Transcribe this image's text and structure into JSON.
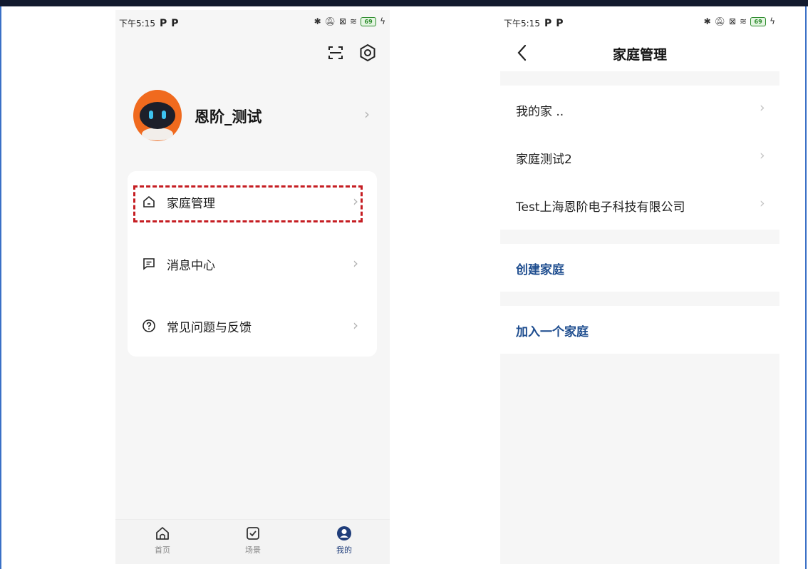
{
  "status_bar": {
    "time": "下午5:15",
    "battery": "69"
  },
  "left_screen": {
    "profile": {
      "name": "恩阶_测试"
    },
    "menu": [
      {
        "label": "家庭管理",
        "icon": "home-outline-icon"
      },
      {
        "label": "消息中心",
        "icon": "message-icon"
      },
      {
        "label": "常见问题与反馈",
        "icon": "help-circle-icon"
      }
    ],
    "tabs": [
      {
        "label": "首页",
        "icon": "home-icon"
      },
      {
        "label": "场景",
        "icon": "scene-check-icon"
      },
      {
        "label": "我的",
        "icon": "profile-icon",
        "active": true
      }
    ]
  },
  "right_screen": {
    "title": "家庭管理",
    "families": [
      {
        "label": "我的家 .."
      },
      {
        "label": "家庭测试2"
      },
      {
        "label": "Test上海恩阶电子科技有限公司"
      }
    ],
    "create_label": "创建家庭",
    "join_label": "加入一个家庭"
  },
  "colors": {
    "highlight": "#c51d22",
    "link": "#1e4d8f",
    "active_tab": "#1f3d7a",
    "avatar_orange": "#f06a1e",
    "frame": "#3a70c6"
  }
}
